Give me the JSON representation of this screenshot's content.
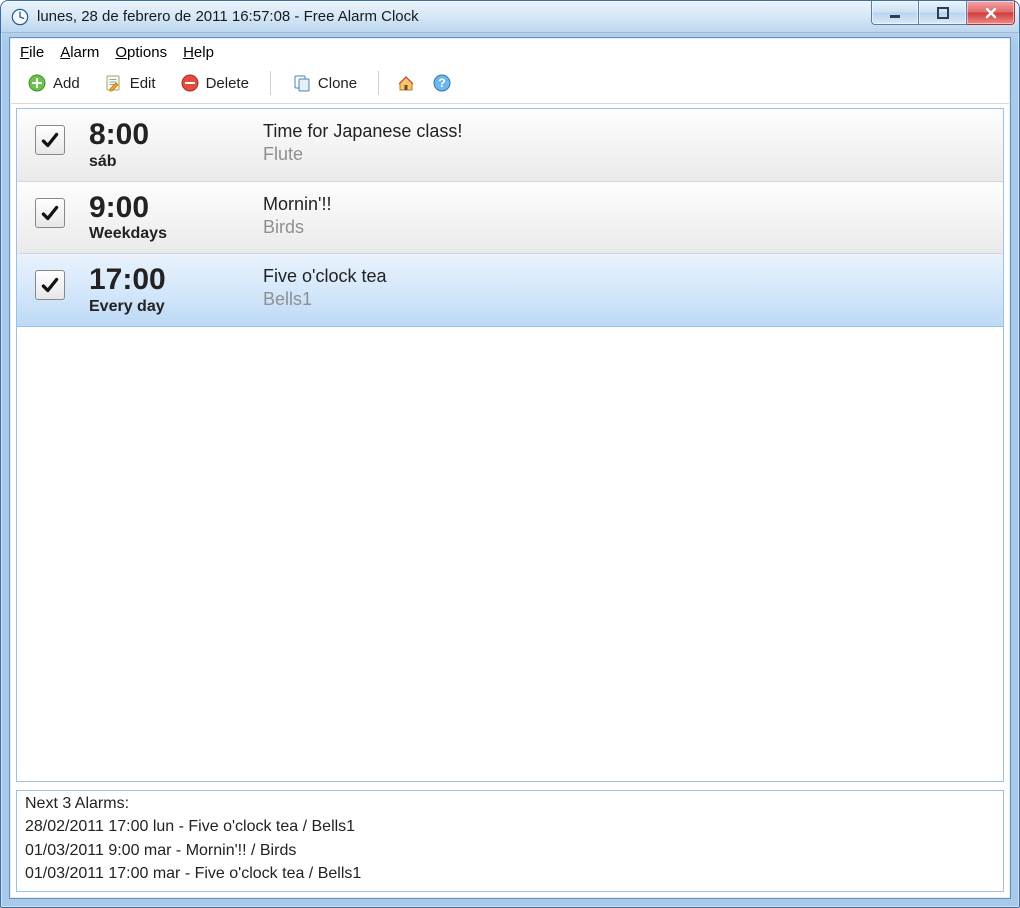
{
  "window": {
    "title": "lunes, 28 de febrero de 2011 16:57:08 - Free Alarm Clock"
  },
  "menu": {
    "file": "File",
    "alarm": "Alarm",
    "options": "Options",
    "help": "Help"
  },
  "toolbar": {
    "add": "Add",
    "edit": "Edit",
    "delete": "Delete",
    "clone": "Clone"
  },
  "alarms": [
    {
      "checked": true,
      "time": "8:00",
      "days": "sáb",
      "desc": "Time for Japanese class!",
      "sound": "Flute",
      "selected": false
    },
    {
      "checked": true,
      "time": "9:00",
      "days": "Weekdays",
      "desc": "Mornin'!!",
      "sound": "Birds",
      "selected": false
    },
    {
      "checked": true,
      "time": "17:00",
      "days": "Every day",
      "desc": "Five o'clock tea",
      "sound": "Bells1",
      "selected": true
    }
  ],
  "next": {
    "header": "Next 3 Alarms:",
    "lines": [
      "28/02/2011 17:00 lun - Five o'clock tea / Bells1",
      "01/03/2011 9:00 mar - Mornin'!! / Birds",
      "01/03/2011 17:00 mar - Five o'clock tea / Bells1"
    ]
  }
}
